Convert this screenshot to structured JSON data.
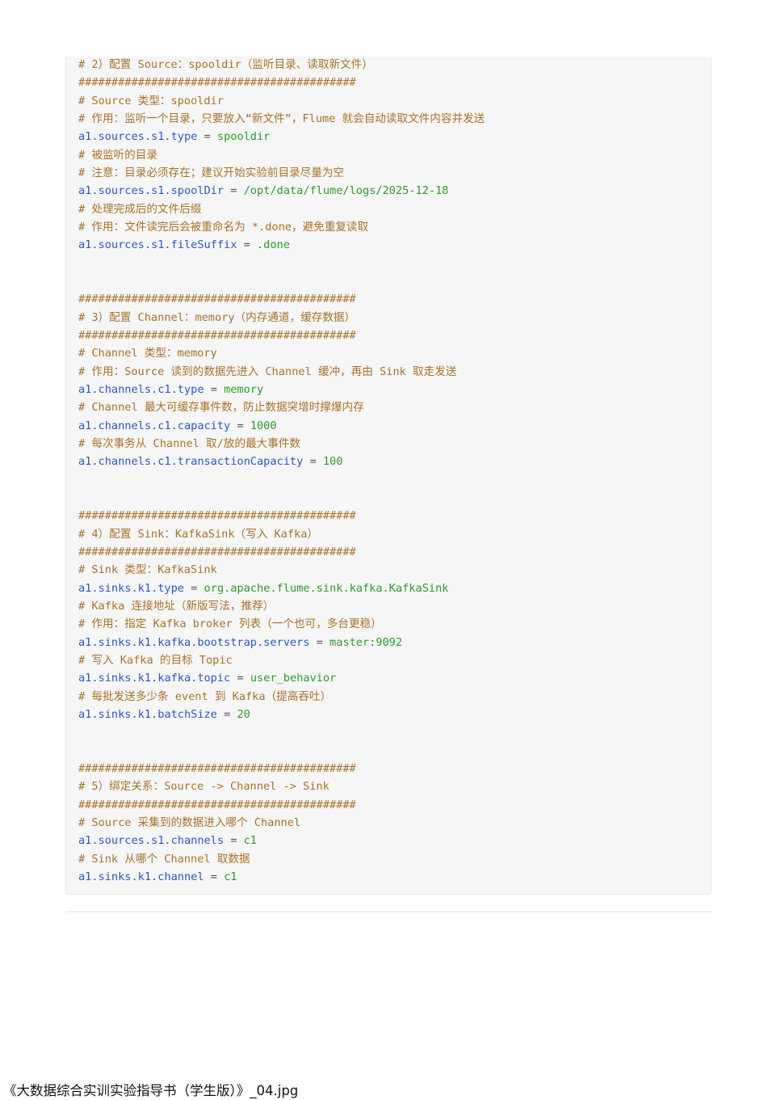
{
  "code_lines": [
    {
      "type": "comment",
      "text": "# 2）配置 Source：spooldir（监听目录、读取新文件）"
    },
    {
      "type": "comment",
      "text": "##########################################"
    },
    {
      "type": "comment",
      "text": "# Source 类型：spooldir"
    },
    {
      "type": "comment",
      "text": "# 作用：监听一个目录，只要放入“新文件”，Flume 就会自动读取文件内容并发送"
    },
    {
      "type": "kv",
      "key": "a1.sources.s1.type",
      "value": "spooldir"
    },
    {
      "type": "comment",
      "text": "# 被监听的目录"
    },
    {
      "type": "comment",
      "text": "# 注意：目录必须存在；建议开始实验前目录尽量为空"
    },
    {
      "type": "kv",
      "key": "a1.sources.s1.spoolDir",
      "value": "/opt/data/flume/logs/2025-12-18"
    },
    {
      "type": "comment",
      "text": "# 处理完成后的文件后缀"
    },
    {
      "type": "comment",
      "text": "# 作用：文件读完后会被重命名为 *.done，避免重复读取"
    },
    {
      "type": "kv",
      "key": "a1.sources.s1.fileSuffix",
      "value": ".done"
    },
    {
      "type": "blank"
    },
    {
      "type": "blank"
    },
    {
      "type": "comment",
      "text": "##########################################"
    },
    {
      "type": "comment",
      "text": "# 3）配置 Channel：memory（内存通道，缓存数据）"
    },
    {
      "type": "comment",
      "text": "##########################################"
    },
    {
      "type": "comment",
      "text": "# Channel 类型：memory"
    },
    {
      "type": "comment",
      "text": "# 作用：Source 读到的数据先进入 Channel 缓冲，再由 Sink 取走发送"
    },
    {
      "type": "kv",
      "key": "a1.channels.c1.type",
      "value": "memory"
    },
    {
      "type": "comment",
      "text": "# Channel 最大可缓存事件数，防止数据突增时撑爆内存"
    },
    {
      "type": "kv",
      "key": "a1.channels.c1.capacity",
      "value": "1000"
    },
    {
      "type": "comment",
      "text": "# 每次事务从 Channel 取/放的最大事件数"
    },
    {
      "type": "kv",
      "key": "a1.channels.c1.transactionCapacity",
      "value": "100"
    },
    {
      "type": "blank"
    },
    {
      "type": "blank"
    },
    {
      "type": "comment",
      "text": "##########################################"
    },
    {
      "type": "comment",
      "text": "# 4）配置 Sink：KafkaSink（写入 Kafka）"
    },
    {
      "type": "comment",
      "text": "##########################################"
    },
    {
      "type": "comment",
      "text": "# Sink 类型：KafkaSink"
    },
    {
      "type": "kv",
      "key": "a1.sinks.k1.type",
      "value": "org.apache.flume.sink.kafka.KafkaSink"
    },
    {
      "type": "comment",
      "text": "# Kafka 连接地址（新版写法，推荐）"
    },
    {
      "type": "comment",
      "text": "# 作用：指定 Kafka broker 列表（一个也可，多台更稳）"
    },
    {
      "type": "kv",
      "key": "a1.sinks.k1.kafka.bootstrap.servers",
      "value": "master:9092"
    },
    {
      "type": "comment",
      "text": "# 写入 Kafka 的目标 Topic"
    },
    {
      "type": "kv",
      "key": "a1.sinks.k1.kafka.topic",
      "value": "user_behavior"
    },
    {
      "type": "comment",
      "text": "# 每批发送多少条 event 到 Kafka（提高吞吐）"
    },
    {
      "type": "kv",
      "key": "a1.sinks.k1.batchSize",
      "value": "20"
    },
    {
      "type": "blank"
    },
    {
      "type": "blank"
    },
    {
      "type": "comment",
      "text": "##########################################"
    },
    {
      "type": "comment",
      "text": "# 5）绑定关系：Source -> Channel -> Sink"
    },
    {
      "type": "comment",
      "text": "##########################################"
    },
    {
      "type": "comment",
      "text": "# Source 采集到的数据进入哪个 Channel"
    },
    {
      "type": "kv",
      "key": "a1.sources.s1.channels",
      "value": "c1"
    },
    {
      "type": "comment",
      "text": "# Sink 从哪个 Channel 取数据"
    },
    {
      "type": "kv",
      "key": "a1.sinks.k1.channel",
      "value": "c1"
    }
  ],
  "assignment_operator": "=",
  "caption": "《大数据综合实训实验指导书（学生版）》_04.jpg",
  "colors": {
    "comment": "#a9712a",
    "key": "#2a57c4",
    "value": "#2d9a2a",
    "code_background": "#f6f6f6"
  }
}
